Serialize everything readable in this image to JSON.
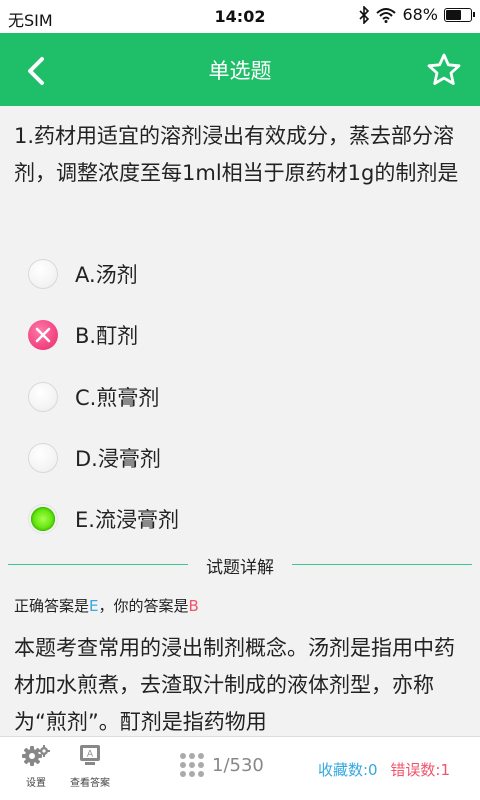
{
  "status_bar": {
    "carrier": "无SIM",
    "time": "14:02",
    "battery": "68%",
    "battery_level": 0.68
  },
  "header": {
    "title": "单选题",
    "back_icon": "chevron-left-icon",
    "favorite_icon": "star-outline-icon"
  },
  "question": {
    "text": "1.药材用适宜的溶剂浸出有效成分，蒸去部分溶剂，调整浓度至每1ml相当于原药材1g的制剂是"
  },
  "options": [
    {
      "label": "A.汤剂",
      "state": "none"
    },
    {
      "label": "B.酊剂",
      "state": "wrong"
    },
    {
      "label": "C.煎膏剂",
      "state": "none"
    },
    {
      "label": "D.浸膏剂",
      "state": "none"
    },
    {
      "label": "E.流浸膏剂",
      "state": "correct"
    }
  ],
  "explanation": {
    "section_title": "试题详解",
    "correct_prefix": "正确答案是",
    "correct_value": "E",
    "user_prefix": "，你的答案是",
    "user_value": "B",
    "text": "本题考查常用的浸出制剂概念。汤剂是指用中药材加水煎煮，去渣取汁制成的液体剂型，亦称为“煎剂”。酊剂是指药物用"
  },
  "bottom_bar": {
    "settings_label": "设置",
    "view_answer_label": "查看答案",
    "view_answer_icon_text": "A",
    "progress": "1/530",
    "favorites": "收藏数:0",
    "errors": "错误数:1"
  },
  "colors": {
    "header_green": "#1fbf6a",
    "wrong_pink": "#f0407d",
    "correct_green": "#67e611",
    "correct_blue": "#35a8e0",
    "error_red": "#f0556b"
  }
}
